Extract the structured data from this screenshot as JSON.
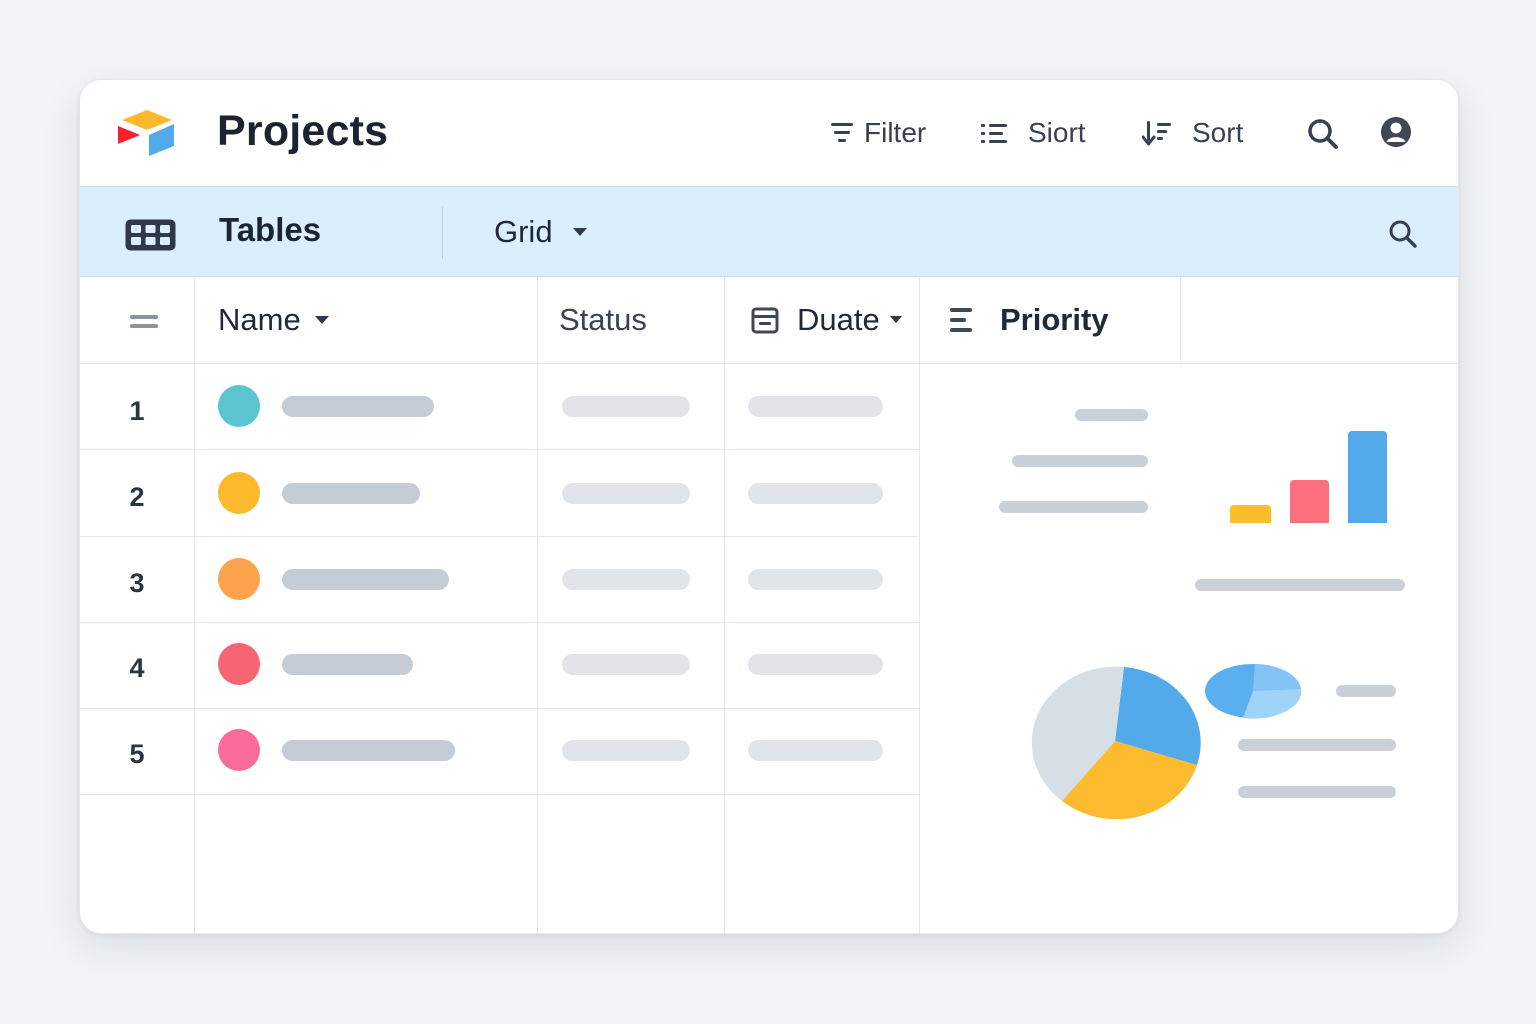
{
  "header": {
    "title": "Projects",
    "logo_icon": "app-logo",
    "filter_label": "Filter",
    "sort_label_1": "Siort",
    "sort_label_2": "Sort",
    "search_icon": "search-icon",
    "account_icon": "user-circle-icon"
  },
  "toolbar": {
    "tables_icon": "table-grid-icon",
    "tables_label": "Tables",
    "view_label": "Grid",
    "view_icon": "caret-down-icon",
    "search_icon": "search-icon"
  },
  "columns": {
    "row_handle_icon": "drag-handle-icon",
    "name": "Name",
    "status": "Status",
    "date": "Duate",
    "priority": "Priority"
  },
  "rows": [
    {
      "number": "1",
      "color": "#5bc4d1"
    },
    {
      "number": "2",
      "color": "#fbb92c"
    },
    {
      "number": "3",
      "color": "#fda34b"
    },
    {
      "number": "4",
      "color": "#f76472"
    },
    {
      "number": "5",
      "color": "#f96b9b"
    }
  ],
  "colors": {
    "accent_blue": "#53aaea",
    "yellow": "#fbb92c",
    "red": "#fe6f7d",
    "toolbar_bg": "#dbeefb"
  }
}
